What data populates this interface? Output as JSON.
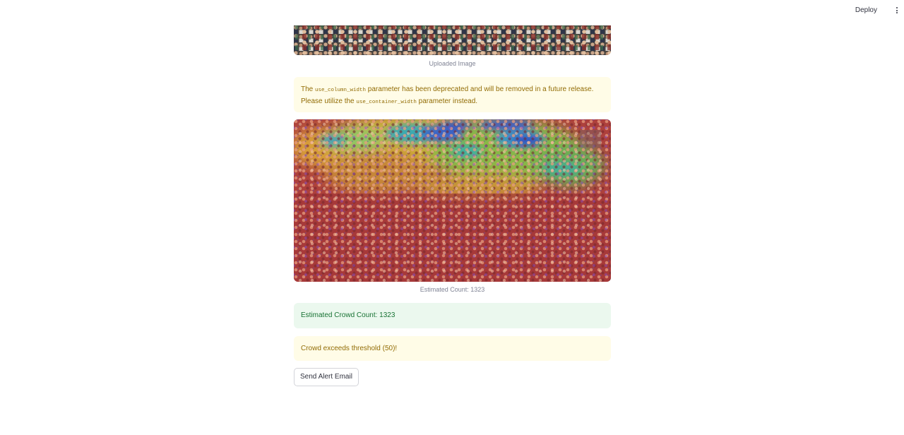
{
  "header": {
    "deploy_label": "Deploy",
    "menu_icon": "kebab-menu-icon"
  },
  "uploaded_image": {
    "caption": "Uploaded Image"
  },
  "deprecation_warning": {
    "text_1": "The ",
    "code_1": "use_column_width",
    "text_2": " parameter has been deprecated and will be removed in a future release. Please utilize the ",
    "code_2": "use_container_width",
    "text_3": " parameter instead."
  },
  "heatmap_image": {
    "caption": "Estimated Count: 1323"
  },
  "results": {
    "success_message": "Estimated Crowd Count: 1323",
    "threshold_warning": "Crowd exceeds threshold (50)!"
  },
  "actions": {
    "send_alert_label": "Send Alert Email"
  },
  "colors": {
    "warning_bg": "#fffce7",
    "warning_text": "#926c05",
    "success_bg": "#ebf8ee",
    "success_text": "#177233"
  }
}
